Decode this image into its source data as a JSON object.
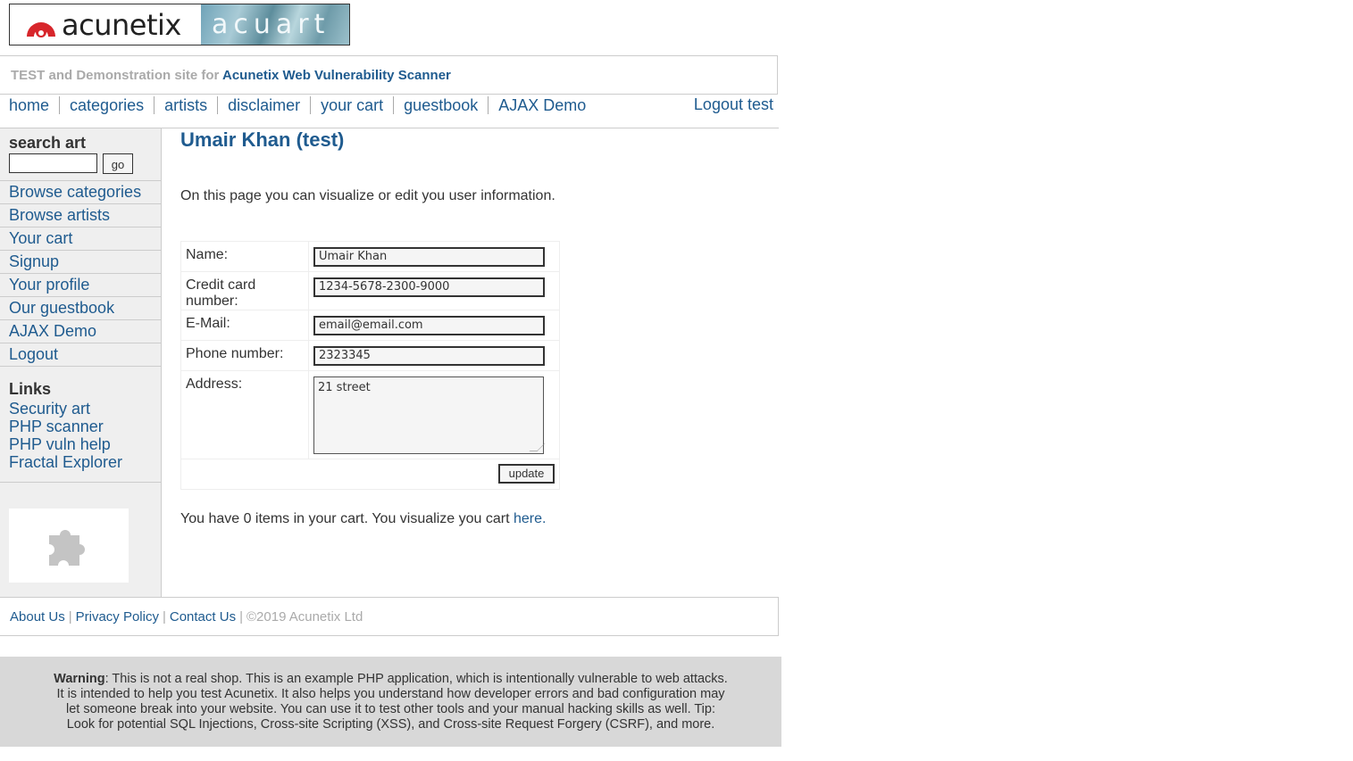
{
  "logo": {
    "brand": "acunetix",
    "product": "acuart"
  },
  "tagline": {
    "prefix": "TEST and Demonstration site for",
    "product_link": "Acunetix Web Vulnerability Scanner"
  },
  "topnav": {
    "items": [
      "home",
      "categories",
      "artists",
      "disclaimer",
      "your cart",
      "guestbook",
      "AJAX Demo"
    ],
    "logout": "Logout test"
  },
  "sidebar": {
    "search_title": "search art",
    "search_value": "",
    "go_label": "go",
    "menu": [
      "Browse categories",
      "Browse artists",
      "Your cart",
      "Signup",
      "Your profile",
      "Our guestbook",
      "AJAX Demo",
      "Logout"
    ],
    "links_title": "Links",
    "links": [
      "Security art",
      "PHP scanner",
      "PHP vuln help",
      "Fractal Explorer"
    ],
    "plugin_icon": "puzzle-piece-icon"
  },
  "main": {
    "title": "Umair Khan (test)",
    "intro": "On this page you can visualize or edit you user information.",
    "form": {
      "name_label": "Name:",
      "name_value": "Umair Khan",
      "cc_label": "Credit card number:",
      "cc_value": "1234-5678-2300-9000",
      "email_label": "E-Mail:",
      "email_value": "email@email.com",
      "phone_label": "Phone number:",
      "phone_value": "2323345",
      "address_label": "Address:",
      "address_value": "21 street",
      "update_label": "update"
    },
    "cart_text": "You have 0 items in your cart. You visualize you cart",
    "cart_link": "here",
    "cart_period": "."
  },
  "footer": {
    "about": "About Us",
    "privacy": "Privacy Policy",
    "contact": "Contact Us",
    "copyright": "©2019 Acunetix Ltd",
    "separator": "|"
  },
  "warning": {
    "label": "Warning",
    "line1": ": This is not a real shop. This is an example PHP application, which is intentionally vulnerable to web attacks.",
    "line2": "It is intended to help you test Acunetix. It also helps you understand how developer errors and bad configuration may",
    "line3": "let someone break into your website. You can use it to test other tools and your manual hacking skills as well. Tip:",
    "line4": "Look for potential SQL Injections, Cross-site Scripting (XSS), and Cross-site Request Forgery (CSRF), and more."
  },
  "colors": {
    "link": "#1f5b8f",
    "sidebar_bg": "#efefef",
    "warning_bg": "#d8d8d8",
    "logo_red": "#d7262b"
  }
}
